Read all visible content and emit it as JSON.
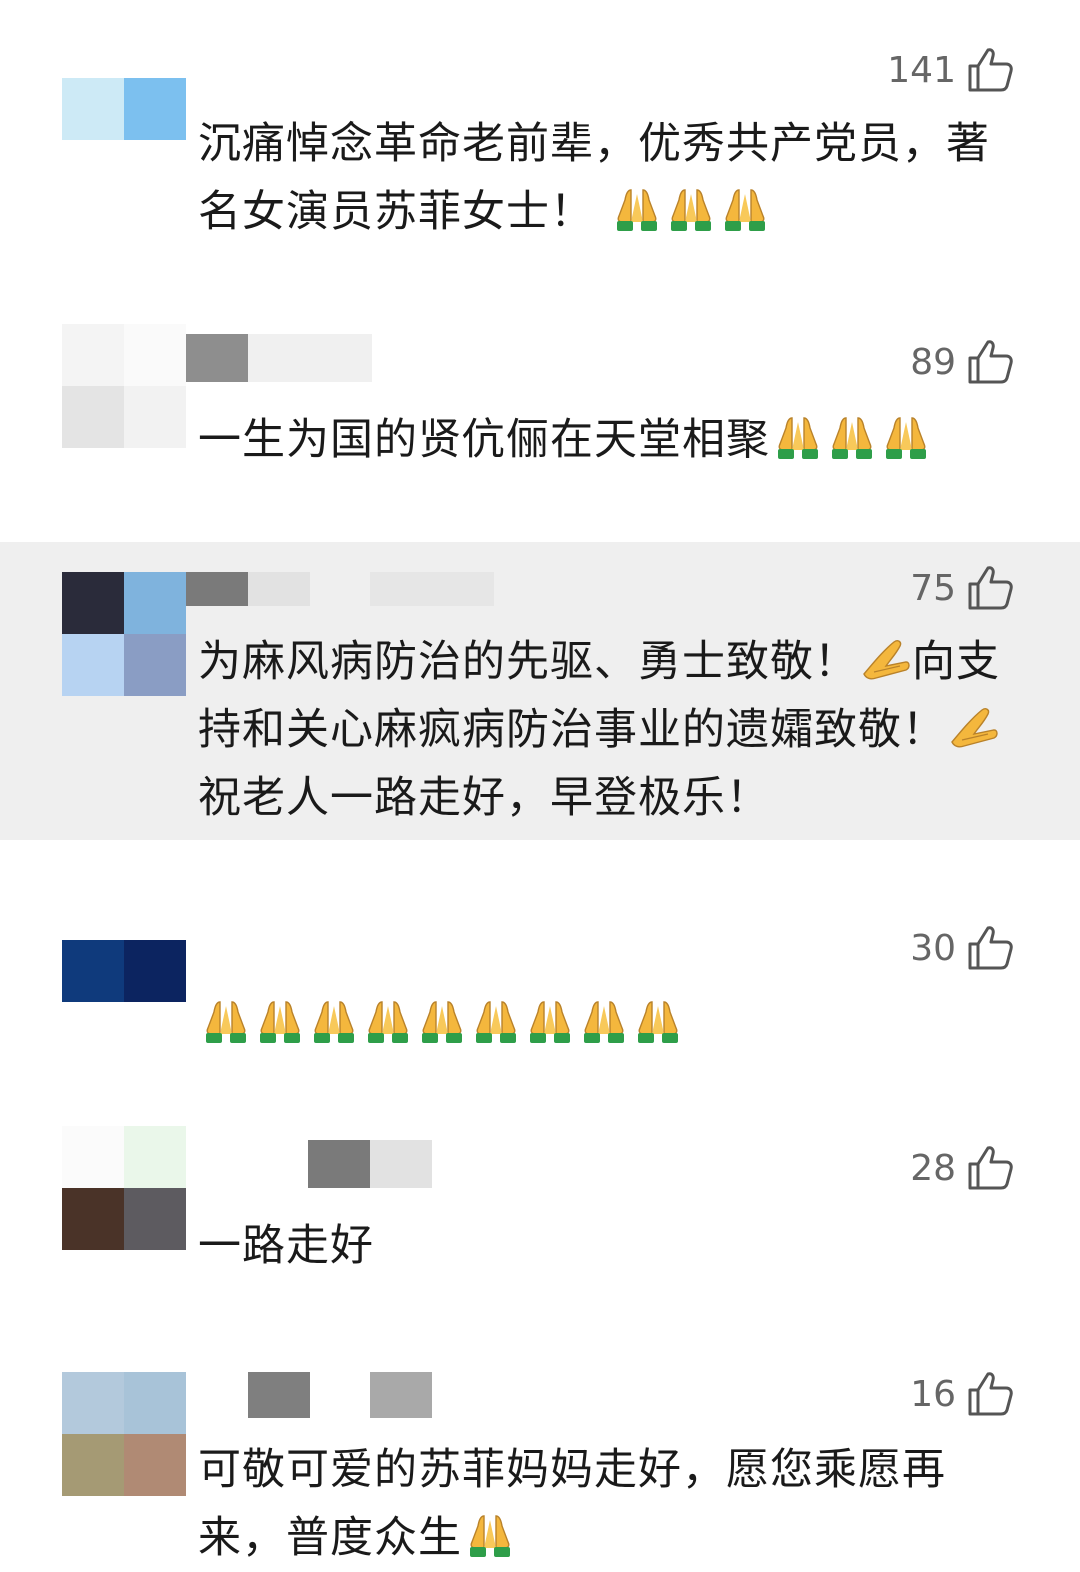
{
  "colors": {
    "highlight_bg": "#efefef",
    "like_gray": "#666666",
    "text": "#1a1a1a",
    "pray_skin": "#f4b73d",
    "pray_sleeve": "#2e9e49"
  },
  "comments": [
    {
      "likes": "141",
      "text": "沉痛悼念革命老前辈，优秀共产党员，著名女演员苏菲女士！",
      "emoji": "pray-folded-hands",
      "emoji_count": 3
    },
    {
      "likes": "89",
      "text": "一生为国的贤伉俪在天堂相聚",
      "emoji": "pray-folded-hands",
      "emoji_count": 3
    },
    {
      "likes": "75",
      "text_part1": "为麻风病防治的先驱、勇士致敬！",
      "text_part2": "向支持和关心麻疯病防治事业的遗孀致敬！",
      "text_part3": "祝老人一路走好，早登极乐！",
      "emoji": "pray-hands-yellow",
      "emoji_count": 2
    },
    {
      "likes": "30",
      "text": "",
      "emoji": "pray-folded-hands",
      "emoji_count": 9
    },
    {
      "likes": "28",
      "text": "一路走好"
    },
    {
      "likes": "16",
      "text": "可敬可爱的苏菲妈妈走好，愿您乘愿再来，普度众生",
      "emoji": "pray-folded-hands",
      "emoji_count": 1
    }
  ],
  "icons": {
    "like": "thumbs-up-outline-icon",
    "pray": "folded-hands-emoji-icon"
  }
}
